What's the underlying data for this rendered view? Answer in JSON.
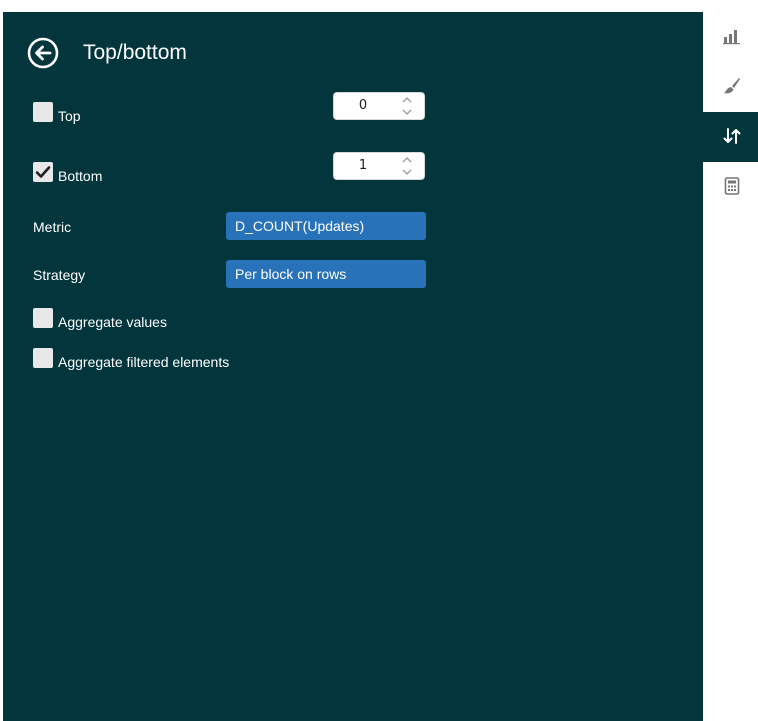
{
  "panel": {
    "title": "Top/bottom",
    "back_icon": "arrow-left-circle-icon"
  },
  "top": {
    "label": "Top",
    "checked": false,
    "value": "0"
  },
  "bottom": {
    "label": "Bottom",
    "checked": true,
    "value": "1"
  },
  "metric": {
    "label": "Metric",
    "value": "D_COUNT(Updates)"
  },
  "strategy": {
    "label": "Strategy",
    "value": "Per block on rows"
  },
  "aggregate_values": {
    "label": "Aggregate values",
    "checked": false
  },
  "aggregate_filtered": {
    "label": "Aggregate filtered elements",
    "checked": false
  },
  "sidebar": {
    "items": [
      {
        "icon": "bar-chart-icon",
        "active": false
      },
      {
        "icon": "paint-brush-icon",
        "active": false
      },
      {
        "icon": "sort-arrows-icon",
        "active": true
      },
      {
        "icon": "calculator-icon",
        "active": false
      }
    ]
  },
  "colors": {
    "panel_bg": "#02353c",
    "select_bg": "#2872b9",
    "icon_gray": "#777777"
  }
}
